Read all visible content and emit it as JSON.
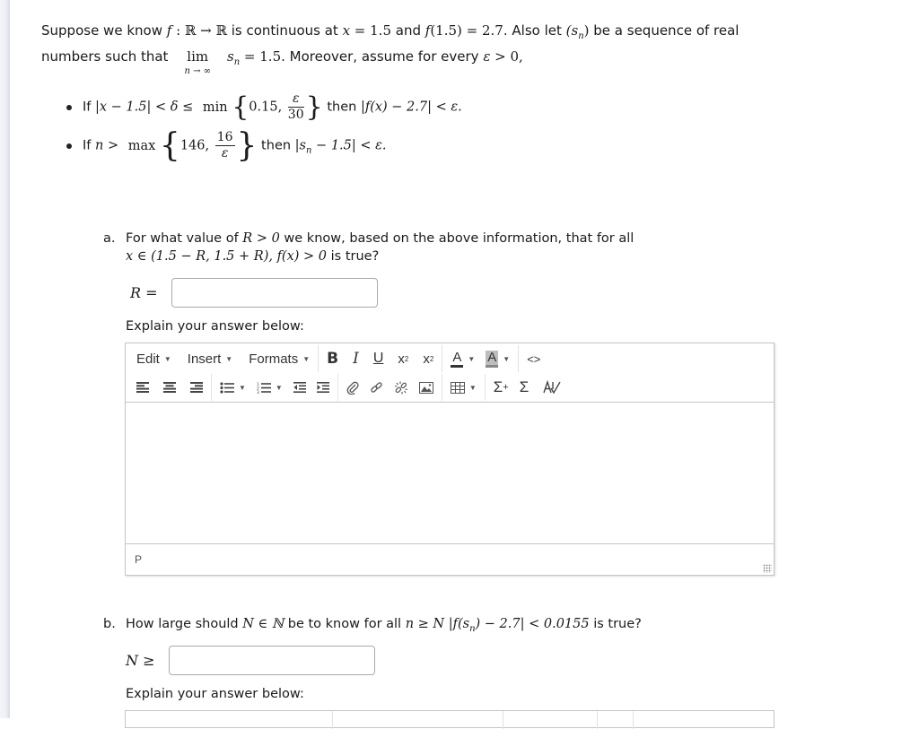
{
  "intro": {
    "line1_parts": [
      "Suppose we know ",
      "f",
      " : ℝ → ℝ",
      " is continuous at ",
      "x",
      " = 1.5",
      " and ",
      "f",
      "(1.5) = 2.7",
      ". Also let ",
      "(s",
      "n",
      ")",
      " be a sequence of real"
    ],
    "line2_prefix": "numbers such that",
    "lim_word": "lim",
    "lim_sub": "n → ∞",
    "lim_expr_s": "s",
    "lim_expr_n": "n",
    "lim_expr_rest": " = 1.5",
    "line2_suffix": ". Moreover, assume for every ",
    "eps": "ε",
    "line2_end": " > 0,"
  },
  "bullets": [
    {
      "if": "If ",
      "lhs": "|x − 1.5| < δ ≤",
      "op": "min",
      "first": "0.15,",
      "frac_num": "ε",
      "frac_den": "30",
      "then": " then ",
      "rhs": "|f(x) − 2.7| < ε."
    },
    {
      "if": "If ",
      "lhs": "n >",
      "op": "max",
      "first": "146,",
      "frac_num": "16",
      "frac_den": "ε",
      "then": " then ",
      "rhs": "|s",
      "rhs_sub": "n",
      "rhs_end": " − 1.5| < ε."
    }
  ],
  "question_a": {
    "letter": "a.",
    "line1_text": "For what value of ",
    "line1_math": "R > 0",
    "line1_rest": " we know, based on the above information, that for all",
    "line2_math": "x ∈ (1.5 − R, 1.5 + R), f(x) > 0",
    "line2_rest": " is true?",
    "answer_label": "R =",
    "answer_value": "",
    "explain_label": "Explain your answer below:"
  },
  "editor": {
    "menus": [
      {
        "label": "Edit",
        "icon": "caret-down-icon"
      },
      {
        "label": "Insert",
        "icon": "caret-down-icon"
      },
      {
        "label": "Formats",
        "icon": "caret-down-icon"
      }
    ],
    "row1_buttons": [
      "bold-icon",
      "italic-icon",
      "underline-icon",
      "subscript-icon",
      "superscript-icon",
      "text-color-icon",
      "background-color-icon",
      "source-code-icon"
    ],
    "row2_buttons": [
      "align-left-icon",
      "align-center-icon",
      "align-right-icon",
      "bullet-list-icon",
      "numbered-list-icon",
      "outdent-icon",
      "indent-icon",
      "attachment-icon",
      "link-icon",
      "unlink-icon",
      "image-icon",
      "table-icon",
      "insert-equation-icon",
      "sum-icon",
      "spellcheck-icon"
    ],
    "bold_glyph": "B",
    "italic_glyph": "I",
    "underline_glyph": "U",
    "subscript_glyph": "x",
    "subscript_mark": "2",
    "superscript_glyph": "x",
    "superscript_mark": "2",
    "color_glyph": "A",
    "code_glyph": "<>",
    "sum_glyph": "Σ",
    "sum_plus": "+",
    "spell_glyph": "A",
    "body": "",
    "status_path": "P"
  },
  "question_b": {
    "letter": "b.",
    "text1": "How large should ",
    "math1": "N ∈ ℕ",
    "text2": " be to know for all ",
    "math2": "n ≥ N  |f(s",
    "math2_sub": "n",
    "math2_end": ") − 2.7| < 0.0155",
    "text3": " is true?",
    "answer_label": "N ≥",
    "answer_value": "",
    "explain_label": "Explain your answer below:"
  }
}
